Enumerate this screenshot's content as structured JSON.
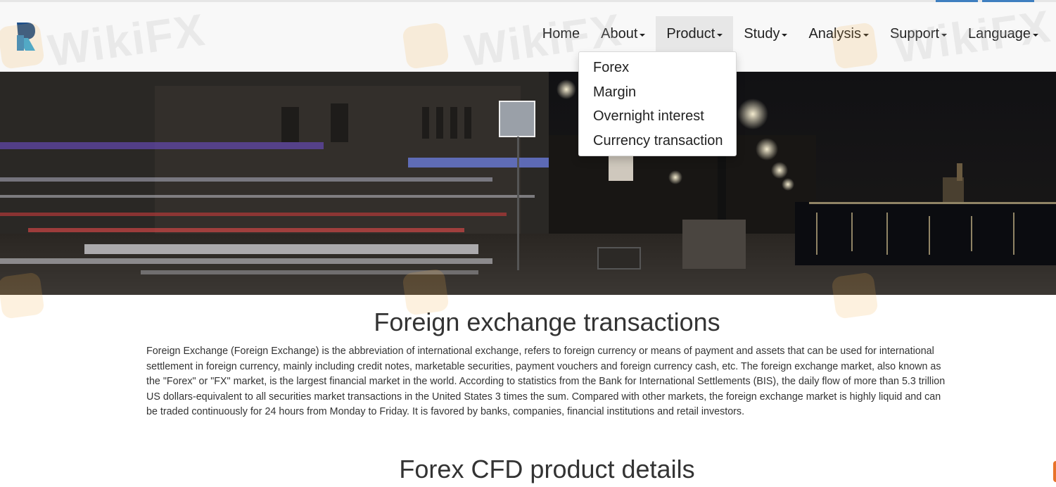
{
  "nav": {
    "items": [
      {
        "label": "Home",
        "has_caret": false,
        "active": false
      },
      {
        "label": "About",
        "has_caret": true,
        "active": false
      },
      {
        "label": "Product",
        "has_caret": true,
        "active": true
      },
      {
        "label": "Study",
        "has_caret": true,
        "active": false
      },
      {
        "label": "Analysis",
        "has_caret": true,
        "active": false
      },
      {
        "label": "Support",
        "has_caret": true,
        "active": false
      },
      {
        "label": "Language",
        "has_caret": true,
        "active": false
      }
    ]
  },
  "product_menu": {
    "items": [
      "Forex",
      "Margin",
      "Overnight interest",
      "Currency transaction"
    ]
  },
  "section1": {
    "title": "Foreign exchange transactions",
    "body": "Foreign Exchange (Foreign Exchange) is the abbreviation of international exchange, refers to foreign currency or means of payment and assets that can be used for international settlement in foreign currency, mainly including credit notes, marketable securities, payment vouchers and foreign currency cash, etc. The foreign exchange market, also known as the \"Forex\" or \"FX\" market, is the largest financial market in the world. According to statistics from the Bank for International Settlements (BIS), the daily flow of more than 5.3 trillion US dollars-equivalent to all securities market transactions in the United States 3 times the sum. Compared with other markets, the foreign exchange market is highly liquid and can be traded continuously for 24 hours from Monday to Friday. It is favored by banks, companies, financial institutions and retail investors."
  },
  "section2": {
    "title": "Forex CFD product details"
  },
  "watermark": "WikiFX",
  "colors": {
    "navbar_bg": "#f8f8f8",
    "active_bg": "#e7e7e7",
    "logo_dark": "#1d4f8a",
    "logo_light": "#2fa8e0",
    "text": "#333333"
  }
}
